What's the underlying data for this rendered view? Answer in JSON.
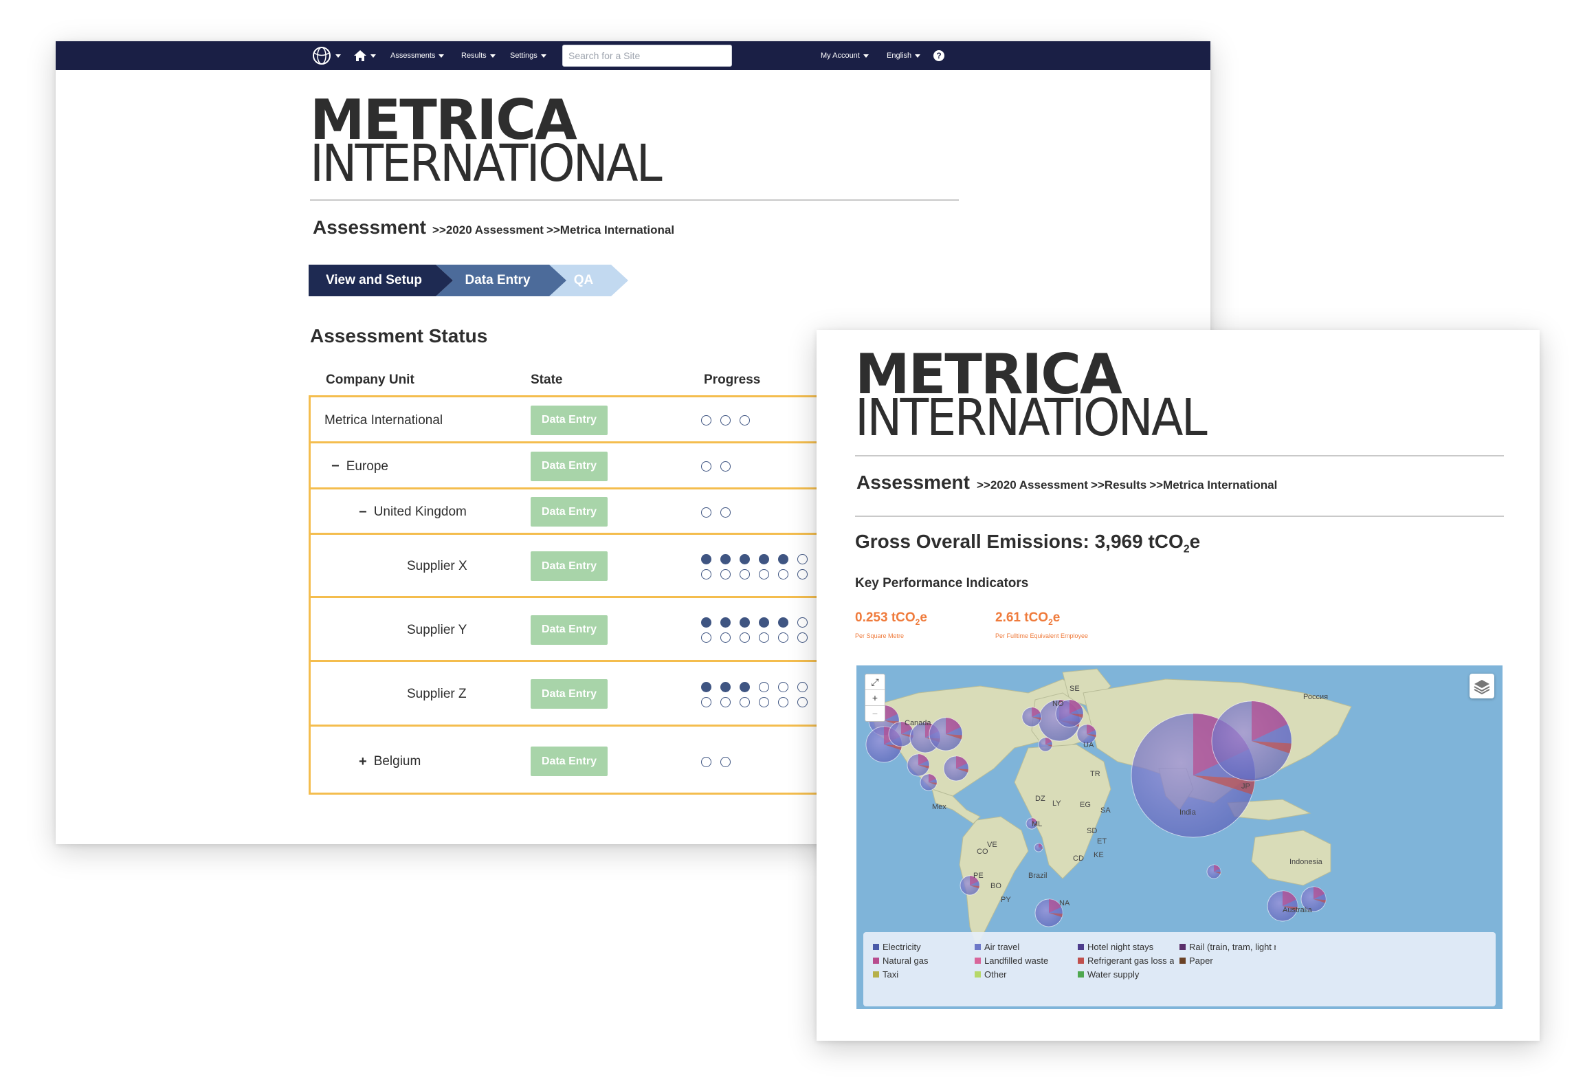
{
  "navbar": {
    "links": [
      "Assessments",
      "Results",
      "Settings"
    ],
    "search_placeholder": "Search for a Site",
    "account": "My Account",
    "language": "English",
    "help": "?"
  },
  "logo": {
    "line1": "METRICA",
    "line2": "INTERNATIONAL"
  },
  "back": {
    "breadcrumb_title": "Assessment",
    "breadcrumbs": [
      ">>2020 Assessment",
      ">>Metrica International"
    ],
    "steps": [
      "View and Setup",
      "Data Entry",
      "QA"
    ],
    "status_title": "Assessment Status",
    "columns": [
      "Company Unit",
      "State",
      "Progress"
    ],
    "rows": [
      {
        "unit": "Metrica International",
        "expander": "",
        "state": "Data Entry",
        "progress_filled": 0,
        "progress_total": 3
      },
      {
        "unit": "Europe",
        "expander": "−",
        "state": "Data Entry",
        "progress_filled": 0,
        "progress_total": 2
      },
      {
        "unit": "United Kingdom",
        "expander": "−",
        "state": "Data Entry",
        "progress_filled": 0,
        "progress_total": 2
      },
      {
        "unit": "Supplier X",
        "expander": "",
        "state": "Data Entry",
        "progress_filled": 5,
        "progress_total": 13
      },
      {
        "unit": "Supplier Y",
        "expander": "",
        "state": "Data Entry",
        "progress_filled": 5,
        "progress_total": 13
      },
      {
        "unit": "Supplier Z",
        "expander": "",
        "state": "Data Entry",
        "progress_filled": 3,
        "progress_total": 13
      },
      {
        "unit": "Belgium",
        "expander": "+",
        "state": "Data Entry",
        "progress_filled": 0,
        "progress_total": 2
      }
    ]
  },
  "front": {
    "breadcrumb_title": "Assessment",
    "breadcrumbs": [
      ">>2020 Assessment",
      ">>Results",
      ">>Metrica International"
    ],
    "gross_label": "Gross Overall Emissions: 3,969 tCO",
    "gross_sub": "2",
    "gross_suffix": "e",
    "kpi_title": "Key Performance Indicators",
    "kpis": [
      {
        "value": "0.253 tCO",
        "sub": "2",
        "suffix": "e",
        "label": "Per Square Metre"
      },
      {
        "value": "2.61 tCO",
        "sub": "2",
        "suffix": "e",
        "label": "Per Fulltime Equivalent Employee"
      }
    ],
    "map": {
      "zoom_in": "+",
      "zoom_out": "−",
      "labels": [
        "Canada",
        "Россия",
        "India",
        "Indonesia",
        "Australia",
        "Brazil",
        "UA",
        "SE",
        "NO",
        "TR",
        "SA",
        "LY",
        "EG",
        "DZ",
        "ML",
        "SD",
        "ET",
        "CD",
        "KE",
        "NA",
        "VE",
        "CO",
        "PE",
        "BO",
        "PY",
        "JP",
        "Mex"
      ],
      "legend": [
        {
          "label": "Electricity",
          "color": "#4a5aa8"
        },
        {
          "label": "Air travel",
          "color": "#6d78c8"
        },
        {
          "label": "Hotel night stays",
          "color": "#4d3c8c"
        },
        {
          "label": "Rail (train, tram, light rail, undergr",
          "color": "#5a2e6a"
        },
        {
          "label": "Natural gas",
          "color": "#b84c8e"
        },
        {
          "label": "Landfilled waste",
          "color": "#d8659a"
        },
        {
          "label": "Refrigerant gas loss and other fu",
          "color": "#c0504d"
        },
        {
          "label": "Paper",
          "color": "#6b4226"
        },
        {
          "label": "Taxi",
          "color": "#b6b04a"
        },
        {
          "label": "Other",
          "color": "#b6d86a"
        },
        {
          "label": "Water supply",
          "color": "#4fa84f"
        }
      ]
    }
  },
  "colors": {
    "nav": "#1a1f45",
    "step_active": "#1e2a52",
    "step_mid": "#4c6b9a",
    "step_light": "#c2d9f0",
    "table_border": "#f4bd4e",
    "state_green": "#a8d4a9",
    "kpi_orange": "#ef7b3c"
  }
}
